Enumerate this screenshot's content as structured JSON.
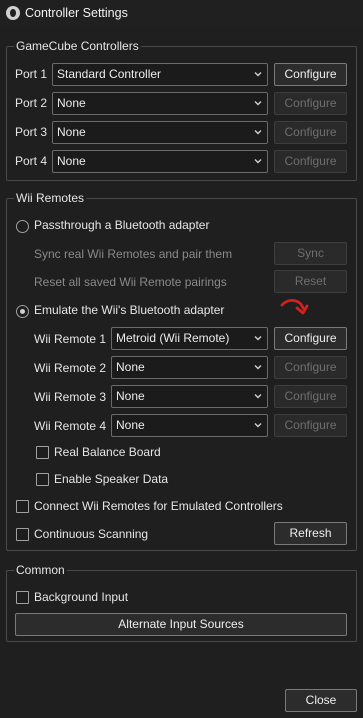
{
  "window": {
    "title": "Controller Settings"
  },
  "gamecube": {
    "title": "GameCube Controllers",
    "configure_label": "Configure",
    "ports": [
      {
        "label": "Port 1",
        "value": "Standard Controller"
      },
      {
        "label": "Port 2",
        "value": "None"
      },
      {
        "label": "Port 3",
        "value": "None"
      },
      {
        "label": "Port 4",
        "value": "None"
      }
    ]
  },
  "wii": {
    "title": "Wii Remotes",
    "passthrough_label": "Passthrough a Bluetooth adapter",
    "sync_text": "Sync real Wii Remotes and pair them",
    "sync_button": "Sync",
    "reset_text": "Reset all saved Wii Remote pairings",
    "reset_button": "Reset",
    "emulate_label": "Emulate the Wii's Bluetooth adapter",
    "emulate_selected": true,
    "configure_label": "Configure",
    "remotes": [
      {
        "label": "Wii Remote 1",
        "value": "Metroid (Wii Remote)"
      },
      {
        "label": "Wii Remote 2",
        "value": "None"
      },
      {
        "label": "Wii Remote 3",
        "value": "None"
      },
      {
        "label": "Wii Remote 4",
        "value": "None"
      }
    ],
    "balance_board_label": "Real Balance Board",
    "speaker_data_label": "Enable Speaker Data",
    "connect_emulated_label": "Connect Wii Remotes for Emulated Controllers",
    "continuous_scanning_label": "Continuous Scanning",
    "refresh_button": "Refresh"
  },
  "common": {
    "title": "Common",
    "background_input_label": "Background Input",
    "alternate_sources_button": "Alternate Input Sources"
  },
  "footer": {
    "close_button": "Close"
  },
  "colors": {
    "annotation": "#d42020",
    "background": "#1f1f1f"
  },
  "icons": {
    "annotation": "red-curved-arrow-icon",
    "dropdown": "chevron-down-icon",
    "app": "dolphin-logo-icon"
  }
}
